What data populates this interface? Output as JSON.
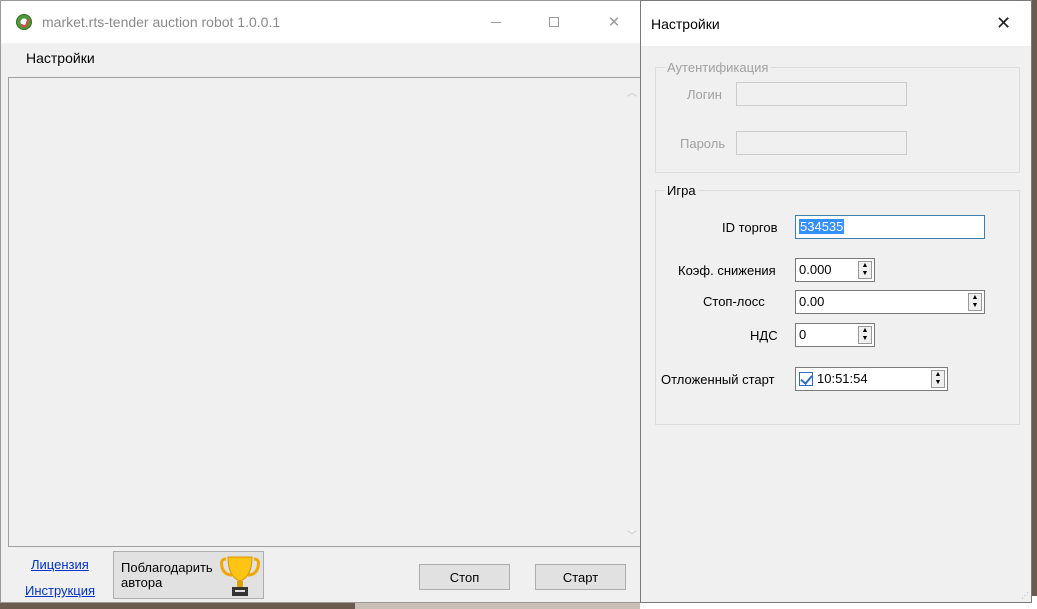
{
  "main_window": {
    "title": "market.rts-tender auction robot 1.0.0.1",
    "menu": {
      "settings_label": "Настройки"
    },
    "links": {
      "license": "Лицензия",
      "instruction": "Инструкция"
    },
    "thank_button": {
      "label_line1": "Поблагодарить",
      "label_line2": "автора",
      "icon": "trophy-icon"
    },
    "buttons": {
      "stop": "Стоп",
      "start": "Старт"
    }
  },
  "settings_dialog": {
    "title": "Настройки",
    "auth_group": {
      "label": "Аутентификация",
      "login_label": "Логин",
      "login_value": "",
      "password_label": "Пароль",
      "password_value": ""
    },
    "game_group": {
      "label": "Игра",
      "trade_id_label": "ID торгов",
      "trade_id_value": "534535",
      "reduction_coef_label": "Коэф. снижения",
      "reduction_coef_value": "0.000",
      "stop_loss_label": "Стоп-лосс",
      "stop_loss_value": "0.00",
      "vat_label": "НДС",
      "vat_value": "0",
      "delayed_start_label": "Отложенный старт",
      "delayed_start_checked": true,
      "delayed_start_time": "10:51:54"
    }
  }
}
